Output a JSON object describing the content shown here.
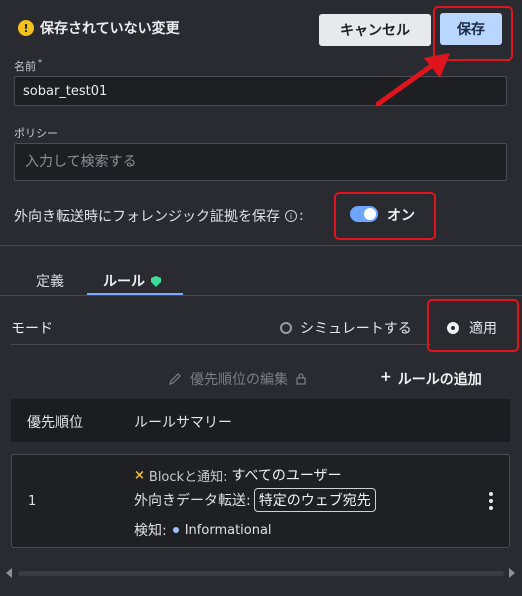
{
  "header": {
    "unsaved_text": "保存されていない変更",
    "warning_glyph": "!",
    "cancel_label": "キャンセル",
    "save_label": "保存"
  },
  "form": {
    "name_label": "名前",
    "name_required_mark": "*",
    "name_value": "sobar_test01",
    "policy_label": "ポリシー",
    "policy_placeholder": "入力して検索する",
    "forensic_label": "外向き転送時にフォレンジック証拠を保存",
    "forensic_suffix": ":",
    "forensic_toggle_on": true,
    "forensic_toggle_text": "オン"
  },
  "tabs": [
    {
      "label": "定義",
      "active": false
    },
    {
      "label": "ルール",
      "active": true
    }
  ],
  "mode": {
    "label": "モード",
    "options": [
      {
        "label": "シミュレートする",
        "selected": false
      },
      {
        "label": "適用",
        "selected": true
      }
    ]
  },
  "rules_toolbar": {
    "edit_priority_label": "優先順位の編集",
    "add_rule_label": "ルールの追加",
    "add_glyph": "+"
  },
  "table": {
    "columns": [
      "優先順位",
      "ルールサマリー"
    ],
    "rows": [
      {
        "priority": "1",
        "action_glyph": "×",
        "action_label": "Blockと通知:",
        "action_target": "すべてのユーザー",
        "transfer_label": "外向きデータ転送:",
        "transfer_value": "特定のウェブ宛先",
        "detection_label": "検知:",
        "detection_value": "Informational"
      }
    ]
  },
  "colors": {
    "background": "#2a2b30",
    "accent_blue": "#6da5ff",
    "save_button": "#b8d6ff",
    "warning_yellow": "#f2c21b",
    "annotation_red": "#e0141c",
    "shield_green": "#3ddc9a",
    "block_x_yellow": "#f2c21b",
    "informational_dot": "#9fc0ff"
  },
  "icons": {
    "warning": "warning-circle-icon",
    "info": "info-circle-icon",
    "shield": "shield-check-icon",
    "pencil": "pencil-icon",
    "lock": "lock-icon",
    "plus": "plus-icon",
    "kebab": "kebab-menu-icon"
  }
}
